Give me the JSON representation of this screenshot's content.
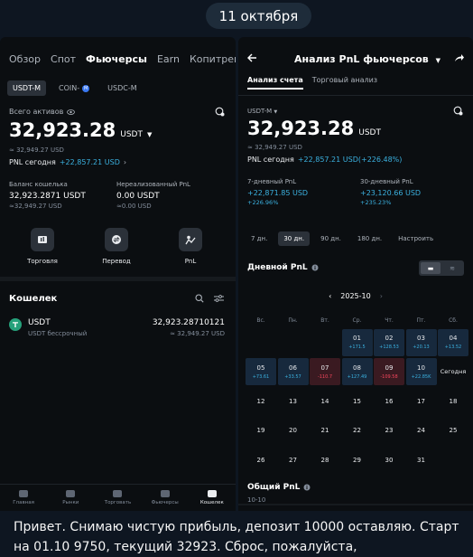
{
  "date_pill": "11 октября",
  "left": {
    "nav": [
      "Обзор",
      "Спот",
      "Фьючерсы",
      "Earn",
      "Копитрейдинг ф"
    ],
    "nav_active": 2,
    "subtabs": [
      "USDT-M",
      "COIN-",
      "USDC-M"
    ],
    "total_label": "Всего активов",
    "total_value": "32,923.28",
    "total_unit": "USDT",
    "total_approx": "≈ 32,949.27 USD",
    "pnl_label": "PNL сегодня",
    "pnl_value": "+22,857.21 USD",
    "balance_label": "Баланс кошелька",
    "balance_value": "32,923.2871 USDT",
    "balance_approx": "≈32,949.27 USD",
    "unrealized_label": "Нереализованный PnL",
    "unrealized_value": "0.00 USDT",
    "unrealized_approx": "≈0.00 USD",
    "actions": [
      "Торговля",
      "Перевод",
      "PnL"
    ],
    "wallet_title": "Кошелек",
    "asset_name": "USDT",
    "asset_sub": "USDT бессрочный",
    "asset_amount": "32,923.28710121",
    "asset_approx": "≈ 32,949.27 USD",
    "bottom_nav": [
      "Главная",
      "Рынки",
      "Торговать",
      "Фьючерсы",
      "Кошелек"
    ]
  },
  "right": {
    "title": "Анализ PnL фьючерсов",
    "tabs": [
      "Анализ счета",
      "Торговый анализ"
    ],
    "currency": "USDT-M",
    "total_value": "32,923.28",
    "total_unit": "USDT",
    "total_approx": "≈ 32,949.27 USD",
    "pnl_label": "PNL сегодня",
    "pnl_value": "+22,857.21 USD(+226.48%)",
    "pnl7_label": "7-дневный PnL",
    "pnl7_value": "+22,871.85 USD",
    "pnl7_pct": "+226.96%",
    "pnl30_label": "30-дневный PnL",
    "pnl30_value": "+23,120.66 USD",
    "pnl30_pct": "+235.23%",
    "periods": [
      "7 дн.",
      "30 дн.",
      "90 дн.",
      "180 дн.",
      "Настроить"
    ],
    "daily_title": "Дневной PnL",
    "month": "2025-10",
    "weekdays": [
      "Вс.",
      "Пн.",
      "Вт.",
      "Ср.",
      "Чт.",
      "Пт.",
      "Сб."
    ],
    "days": [
      {
        "d": "01",
        "p": "+171.5",
        "c": "pos"
      },
      {
        "d": "02",
        "p": "+128.53",
        "c": "pos"
      },
      {
        "d": "03",
        "p": "+20.13",
        "c": "pos"
      },
      {
        "d": "04",
        "p": "+13.52",
        "c": "pos"
      },
      {
        "d": "05",
        "p": "+73.61",
        "c": "pos"
      },
      {
        "d": "06",
        "p": "+33.57",
        "c": "pos"
      },
      {
        "d": "07",
        "p": "-110.7",
        "c": "neg"
      },
      {
        "d": "08",
        "p": "+127.49",
        "c": "pos"
      },
      {
        "d": "09",
        "p": "-109.58",
        "c": "neg"
      },
      {
        "d": "10",
        "p": "+22.85K",
        "c": "pos"
      }
    ],
    "today_label": "Сегодня",
    "future_days": [
      "12",
      "13",
      "14",
      "15",
      "16",
      "17",
      "18",
      "19",
      "20",
      "21",
      "22",
      "23",
      "24",
      "25",
      "26",
      "27",
      "28",
      "29",
      "30",
      "31"
    ],
    "total_pnl_title": "Общий PnL",
    "total_pnl_date": "10-10"
  },
  "message": "Привет. Снимаю чистую прибыль, депозит 10000 оставляю. Старт на 01.10 9750, текущий 32923. Сброс, пожалуйста,",
  "colors": {
    "green": "#2ebd85",
    "red": "#f6465d",
    "bg": "#0b0e11",
    "chat_bg": "#0e1621"
  }
}
